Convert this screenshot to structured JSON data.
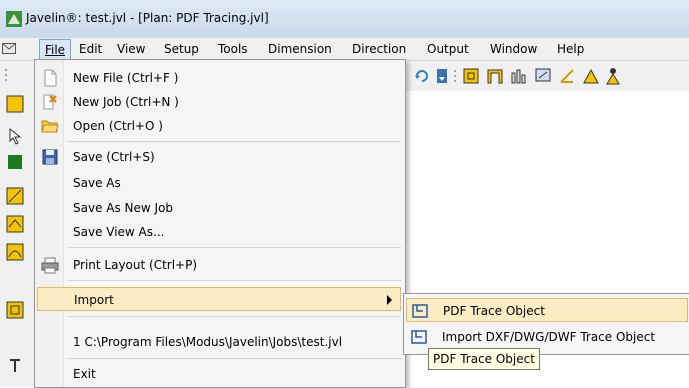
{
  "window": {
    "title": "Javelin®: test.jvl - [Plan: PDF Tracing.jvl]"
  },
  "menubar": {
    "items": [
      {
        "label": "File"
      },
      {
        "label": "Edit"
      },
      {
        "label": "View"
      },
      {
        "label": "Setup"
      },
      {
        "label": "Tools"
      },
      {
        "label": "Dimension"
      },
      {
        "label": "Direction"
      },
      {
        "label": "Output"
      },
      {
        "label": "Window"
      },
      {
        "label": "Help"
      }
    ]
  },
  "file_menu": {
    "new_file": "New File (Ctrl+F )",
    "new_job": "New Job (Ctrl+N )",
    "open": "Open (Ctrl+O )",
    "save": "Save (Ctrl+S)",
    "save_as": "Save As",
    "save_as_new_job": "Save As New Job",
    "save_view_as": "Save View As...",
    "print_layout": "Print Layout (Ctrl+P)",
    "import": "Import",
    "recent_file": "1 C:\\Program Files\\Modus\\Javelin\\Jobs\\test.jvl",
    "exit": "Exit"
  },
  "import_submenu": {
    "pdf_trace": "PDF Trace Object",
    "dxf_trace": "Import DXF/DWG/DWF Trace Object"
  },
  "tooltip": {
    "text": "PDF Trace Object"
  },
  "colors": {
    "highlight": "#fcecc3",
    "highlight_border": "#d9ba6e",
    "menubar_active": "#d8e6f7"
  }
}
